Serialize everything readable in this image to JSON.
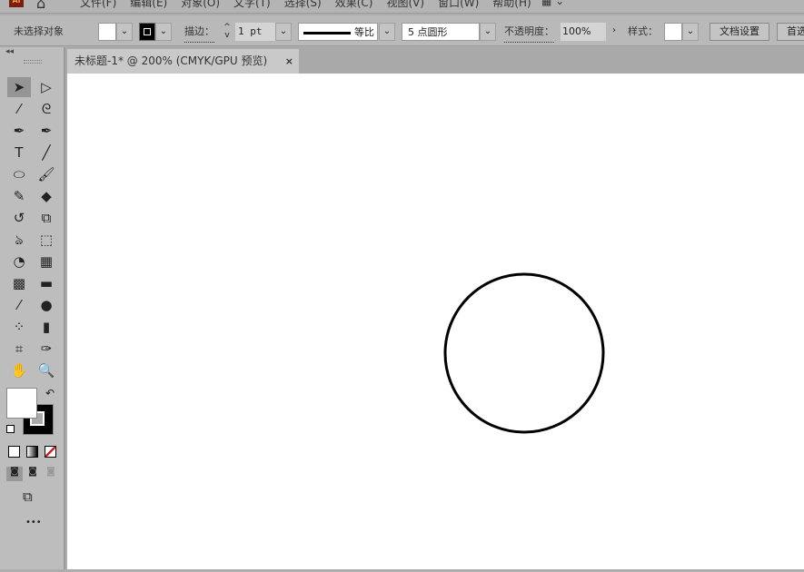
{
  "menubar": {
    "logo": "Ai",
    "menus": [
      "文件(F)",
      "编辑(E)",
      "对象(O)",
      "文字(T)",
      "选择(S)",
      "效果(C)",
      "视图(V)",
      "窗口(W)",
      "帮助(H)"
    ]
  },
  "control": {
    "selection_status": "未选择对象",
    "stroke_label": "描边：",
    "stroke_weight": "1 pt",
    "stroke_profile": "等比",
    "brush": "5 点圆形",
    "opacity_label": "不透明度：",
    "opacity": "100%",
    "style_label": "样式：",
    "doc_setup": "文档设置",
    "prefs": "首选项"
  },
  "tab": {
    "title": "未标题-1* @ 200% (CMYK/GPU 预览)",
    "close": "×"
  },
  "tools": [
    {
      "name": "selection-tool",
      "glyph": "➤"
    },
    {
      "name": "direct-selection-tool",
      "glyph": "▷"
    },
    {
      "name": "magic-wand-tool",
      "glyph": "⁄"
    },
    {
      "name": "lasso-tool",
      "glyph": "ᘓ"
    },
    {
      "name": "pen-tool",
      "glyph": "✒"
    },
    {
      "name": "curvature-tool",
      "glyph": "✒"
    },
    {
      "name": "type-tool",
      "glyph": "T"
    },
    {
      "name": "line-tool",
      "glyph": "╱"
    },
    {
      "name": "ellipse-tool",
      "glyph": "⬭"
    },
    {
      "name": "paintbrush-tool",
      "glyph": "🖌"
    },
    {
      "name": "shaper-tool",
      "glyph": "✎"
    },
    {
      "name": "eraser-tool",
      "glyph": "◆"
    },
    {
      "name": "rotate-tool",
      "glyph": "↺"
    },
    {
      "name": "scale-tool",
      "glyph": "⧉"
    },
    {
      "name": "warp-tool",
      "glyph": "ঌ"
    },
    {
      "name": "free-transform-tool",
      "glyph": "⬚"
    },
    {
      "name": "shape-builder-tool",
      "glyph": "◔"
    },
    {
      "name": "perspective-grid-tool",
      "glyph": "▦"
    },
    {
      "name": "mesh-tool",
      "glyph": "▩"
    },
    {
      "name": "gradient-tool",
      "glyph": "▬"
    },
    {
      "name": "eyedropper-tool",
      "glyph": "⁄"
    },
    {
      "name": "blend-tool",
      "glyph": "●"
    },
    {
      "name": "symbol-sprayer-tool",
      "glyph": "⁘"
    },
    {
      "name": "column-graph-tool",
      "glyph": "▮"
    },
    {
      "name": "artboard-tool",
      "glyph": "⌗"
    },
    {
      "name": "slice-tool",
      "glyph": "✑"
    },
    {
      "name": "hand-tool",
      "glyph": "✋"
    },
    {
      "name": "zoom-tool",
      "glyph": "🔍"
    }
  ],
  "colors": {
    "fill": "#ffffff",
    "stroke": "#000000",
    "none_slash": "#d0202a"
  },
  "more": "•••"
}
